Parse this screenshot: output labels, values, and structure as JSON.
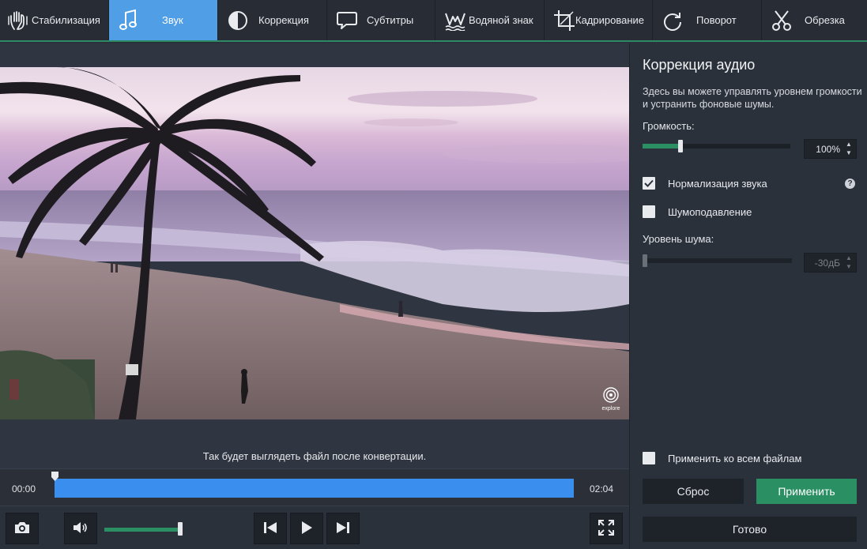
{
  "toolbar": {
    "tabs": [
      {
        "label": "Стабилизация",
        "icon": "hand-stabilize-icon"
      },
      {
        "label": "Звук",
        "icon": "music-note-icon",
        "active": true
      },
      {
        "label": "Коррекция",
        "icon": "contrast-icon"
      },
      {
        "label": "Субтитры",
        "icon": "speech-bubble-icon"
      },
      {
        "label": "Водяной знак",
        "icon": "watermark-icon"
      },
      {
        "label": "Кадрирование",
        "icon": "crop-icon"
      },
      {
        "label": "Поворот",
        "icon": "rotate-icon"
      },
      {
        "label": "Обрезка",
        "icon": "scissors-icon"
      }
    ],
    "active_color": "#4f9ee6",
    "accent_line_color": "#2e8a64"
  },
  "preview": {
    "caption": "Так будет выглядеть файл после конвертации.",
    "watermark_text": "explore"
  },
  "timeline": {
    "time_start": "00:00",
    "time_end": "02:04",
    "playhead_position": 0,
    "track_color": "#3a8fee"
  },
  "controls": {
    "snapshot_icon": "camera-icon",
    "volume_icon": "speaker-icon",
    "volume_level": 0.97,
    "prev_icon": "skip-previous-icon",
    "play_icon": "play-icon",
    "next_icon": "skip-next-icon",
    "fullscreen_icon": "fullscreen-icon"
  },
  "panel": {
    "title": "Коррекция аудио",
    "description": "Здесь вы можете управлять уровнем громкости и устранить фоновые шумы.",
    "volume_label": "Громкость:",
    "volume_value": "100%",
    "volume_level": 0.26,
    "normalize_label": "Нормализация звука",
    "normalize_checked": true,
    "noise_reduction_label": "Шумоподавление",
    "noise_reduction_checked": false,
    "noise_level_label": "Уровень шума:",
    "noise_level_value": "-30дБ",
    "noise_level": 0.0,
    "apply_all_label": "Применить ко всем файлам",
    "apply_all_checked": false,
    "reset_label": "Сброс",
    "apply_label": "Применить",
    "done_label": "Готово",
    "apply_color": "#2a8f63"
  }
}
